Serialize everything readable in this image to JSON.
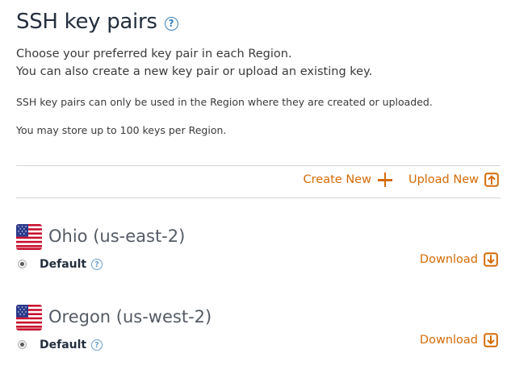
{
  "header": {
    "title": "SSH key pairs",
    "help_icon": "?"
  },
  "intro": {
    "line1": "Choose your preferred key pair in each Region.",
    "line2": "You can also create a new key pair or upload an existing key."
  },
  "notes": {
    "region_scope": "SSH key pairs can only be used in the Region where they are created or uploaded.",
    "limit": "You may store up to 100 keys per Region."
  },
  "actions": {
    "create_label": "Create New",
    "upload_label": "Upload New",
    "accent_color": "#d46b08"
  },
  "regions": [
    {
      "name": "Ohio (us-east-2)",
      "flag_icon": "us-flag-icon",
      "selected_key": "Default",
      "help_icon": "?",
      "download_label": "Download"
    },
    {
      "name": "Oregon (us-west-2)",
      "flag_icon": "us-flag-icon",
      "selected_key": "Default",
      "help_icon": "?",
      "download_label": "Download"
    }
  ]
}
